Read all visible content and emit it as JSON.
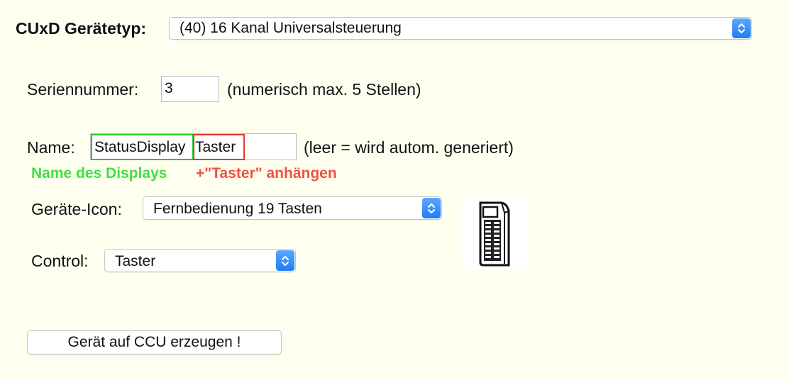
{
  "header": {
    "device_type_label": "CUxD Gerätetyp:",
    "device_type_value": "(40) 16 Kanal Universalsteuerung"
  },
  "serial": {
    "label": "Seriennummer:",
    "value": "3",
    "hint": "(numerisch max. 5 Stellen)"
  },
  "name": {
    "label": "Name:",
    "value_part_display": "StatusDisplay",
    "value_part_suffix": "Taster",
    "hint": "(leer = wird autom. generiert)",
    "annotation_green": "Name des Displays",
    "annotation_red": "+\"Taster\" anhängen"
  },
  "device_icon": {
    "label": "Geräte-Icon:",
    "value": "Fernbedienung 19 Tasten"
  },
  "control": {
    "label": "Control:",
    "value": "Taster"
  },
  "create_button": {
    "label": "Gerät auf CCU erzeugen !"
  },
  "colors": {
    "background": "#fffff0",
    "annotation_green": "#3ee23e",
    "annotation_red": "#f0533b",
    "select_accent": "#1f7cf3"
  },
  "icons": {
    "stepper": "up-down-chevron-icon",
    "device_preview": "remote-control-19-keys-icon"
  }
}
